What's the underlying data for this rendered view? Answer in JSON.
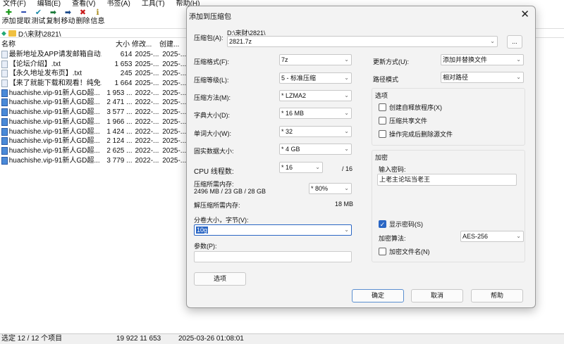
{
  "menubar": [
    "文件(F)",
    "编辑(E)",
    "查看(V)",
    "书签(A)",
    "工具(T)",
    "帮助(H)"
  ],
  "toolbar": [
    {
      "label": "添加",
      "icon": "plus-icon",
      "glyph": "✚",
      "color": "#1a9a1a"
    },
    {
      "label": "提取",
      "icon": "minus-icon",
      "glyph": "━",
      "color": "#1a3aa8"
    },
    {
      "label": "测试",
      "icon": "check-icon",
      "glyph": "✔",
      "color": "#1a8aa8"
    },
    {
      "label": "复制",
      "icon": "copy-arrow-icon",
      "glyph": "➡",
      "color": "#1a7a3a"
    },
    {
      "label": "移动",
      "icon": "move-arrow-icon",
      "glyph": "➡",
      "color": "#1a4a8a"
    },
    {
      "label": "删除",
      "icon": "delete-icon",
      "glyph": "✖",
      "color": "#c81a1a"
    },
    {
      "label": "信息",
      "icon": "info-icon",
      "glyph": "ℹ",
      "color": "#a88a1a"
    }
  ],
  "address": "D:\\来财\\2821\\",
  "columns": {
    "name": "名称",
    "size": "大小",
    "modified": "修改...",
    "created": "创建..."
  },
  "files": [
    {
      "name": "最新地址及APP请发邮箱自动...",
      "size": "614",
      "modified": "2025-...",
      "created": "2025-...",
      "icon": "text-file"
    },
    {
      "name": "【论坛介绍】.txt",
      "size": "1 653",
      "modified": "2025-...",
      "created": "2025-...",
      "icon": "text-file"
    },
    {
      "name": "【永久地址发布页】.txt",
      "size": "245",
      "modified": "2025-...",
      "created": "2025-...",
      "icon": "text-file"
    },
    {
      "name": "【来了就能下载和观看！纯免...",
      "size": "1 664",
      "modified": "2025-...",
      "created": "2025-...",
      "icon": "text-file"
    },
    {
      "name": "huachishe.vip-91新人GD超...",
      "size": "1 953 ...",
      "modified": "2022-...",
      "created": "2025-...",
      "icon": "image-file"
    },
    {
      "name": "huachishe.vip-91新人GD超...",
      "size": "2 471 ...",
      "modified": "2022-...",
      "created": "2025-...",
      "icon": "image-file"
    },
    {
      "name": "huachishe.vip-91新人GD超...",
      "size": "3 577 ...",
      "modified": "2022-...",
      "created": "2025-...",
      "icon": "image-file"
    },
    {
      "name": "huachishe.vip-91新人GD超...",
      "size": "1 966 ...",
      "modified": "2022-...",
      "created": "2025-...",
      "icon": "image-file"
    },
    {
      "name": "huachishe.vip-91新人GD超...",
      "size": "1 424 ...",
      "modified": "2022-...",
      "created": "2025-...",
      "icon": "image-file"
    },
    {
      "name": "huachishe.vip-91新人GD超...",
      "size": "2 124 ...",
      "modified": "2022-...",
      "created": "2025-...",
      "icon": "image-file"
    },
    {
      "name": "huachishe.vip-91新人GD超...",
      "size": "2 625 ...",
      "modified": "2022-...",
      "created": "2025-...",
      "icon": "image-file"
    },
    {
      "name": "huachishe.vip-91新人GD超...",
      "size": "3 779 ...",
      "modified": "2022-...",
      "created": "2025-...",
      "icon": "image-file"
    }
  ],
  "status": {
    "selection": "选定 12 / 12 个项目",
    "size": "19 922 11 653",
    "datetime": "2025-03-26 01:08:01"
  },
  "dialog": {
    "title": "添加到压缩包",
    "archive_label": "压缩包(A):",
    "archive_dir": "D:\\来财\\2821\\",
    "archive_name": "2821.7z",
    "browse": "...",
    "format_label": "压缩格式(F):",
    "format": "7z",
    "level_label": "压缩等级(L):",
    "level": "5 - 标准压缩",
    "method_label": "压缩方法(M):",
    "method": "*  LZMA2",
    "dict_label": "字典大小(D):",
    "dict": "*  16 MB",
    "word_label": "单词大小(W):",
    "word": "*  32",
    "solid_label": "固实数据大小:",
    "solid": "*  4 GB",
    "cpu_label": "CPU 线程数:",
    "cpu": "*  16",
    "cpu_max": "/ 16",
    "mem_compress_label": "压缩所需内存:",
    "mem_compress_value": "2496 MB / 23 GB / 28 GB",
    "mem_percent": "* 80%",
    "mem_decompress_label": "解压缩所需内存:",
    "mem_decompress_value": "18 MB",
    "split_label": "分卷大小，字节(V):",
    "split": "10g",
    "params_label": "参数(P):",
    "params": "",
    "options_button": "选项",
    "update_label": "更新方式(U):",
    "update": "添加并替换文件",
    "path_label": "路径模式",
    "path": "相对路径",
    "options_group": "选项",
    "opt_sfx": "创建自释放程序(X)",
    "opt_shared": "压缩共享文件",
    "opt_delete": "操作完成后删除源文件",
    "encrypt_group": "加密",
    "password_label": "输入密码:",
    "password": "上老主论坛当老王",
    "show_password": "显示密码(S)",
    "enc_method_label": "加密算法:",
    "enc_method": "AES-256",
    "encrypt_names": "加密文件名(N)",
    "ok": "确定",
    "cancel": "取消",
    "help": "帮助"
  }
}
